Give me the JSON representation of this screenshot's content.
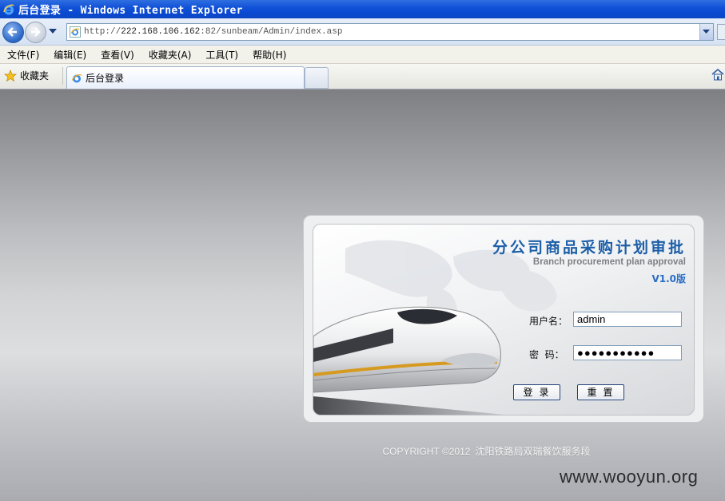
{
  "window": {
    "title": "后台登录 - Windows Internet Explorer"
  },
  "address": {
    "url_scheme": "http://",
    "url_host": "222.168.106.162",
    "url_rest": ":82/sunbeam/Admin/index.asp"
  },
  "menu": [
    "文件(F)",
    "编辑(E)",
    "查看(V)",
    "收藏夹(A)",
    "工具(T)",
    "帮助(H)"
  ],
  "favorites": {
    "label": "收藏夹"
  },
  "tab": {
    "label": "后台登录"
  },
  "login": {
    "title": "分公司商品采购计划审批",
    "subtitle": "Branch procurement plan approval",
    "version": "V1.0版",
    "username_label": "用户名：",
    "username_value": "admin",
    "password_label": "密  码：",
    "password_value": "●●●●●●●●●●●",
    "login_button": "登录",
    "reset_button": "重置"
  },
  "footer": {
    "copyright": "COPYRIGHT ©2012",
    "org": "沈阳铁路局双瑞餐饮服务段"
  },
  "watermark": "www.wooyun.org"
}
